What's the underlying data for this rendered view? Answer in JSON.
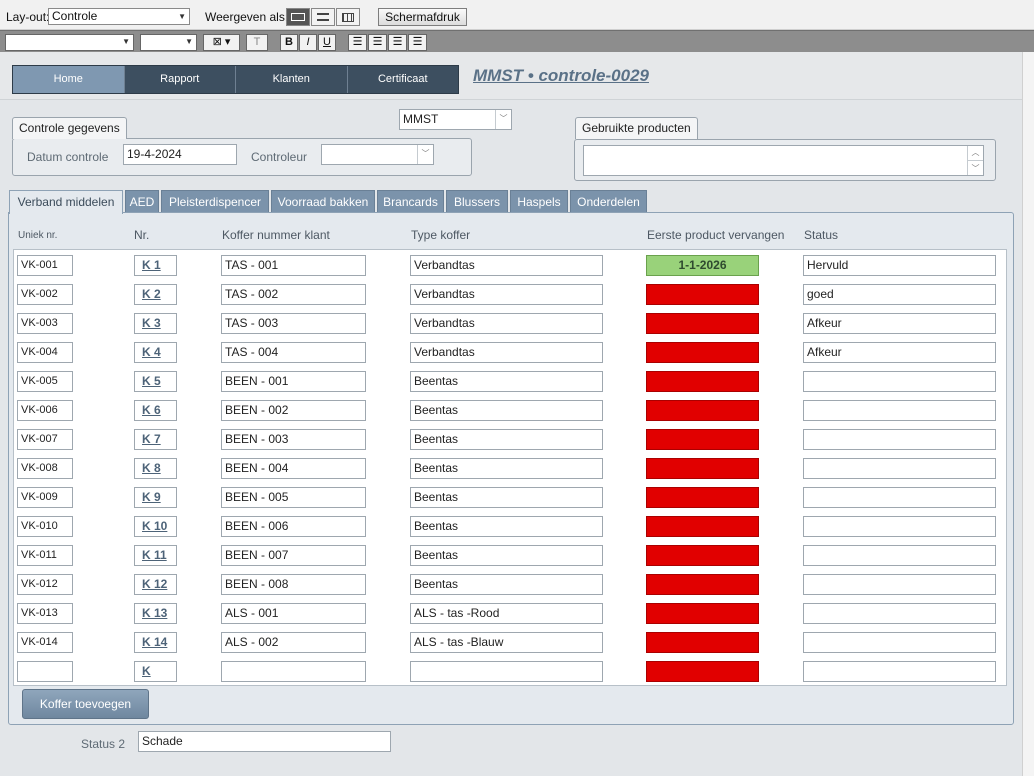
{
  "toolbar": {
    "layout_label": "Lay-out:",
    "layout_value": "Controle",
    "view_label": "Weergeven als:",
    "screenshot_button": "Schermafdruk",
    "format_bold": "B",
    "format_italic": "I",
    "format_underline": "U",
    "format_text": "T"
  },
  "nav": {
    "items": [
      "Home",
      "Rapport",
      "Klanten",
      "Certificaat"
    ],
    "active": "Home"
  },
  "page_title": "MMST  •  controle-0029",
  "controle": {
    "group_title": "Controle gegevens",
    "date_label": "Datum controle",
    "date_value": "19-4-2024",
    "controleur_label": "Controleur",
    "controleur_value": "",
    "company_value": "MMST"
  },
  "products": {
    "group_title": "Gebruikte producten",
    "value": ""
  },
  "tabs": [
    "Verband middelen",
    "AED",
    "Pleisterdispencer",
    "Voorraad bakken",
    "Brancards",
    "Blussers",
    "Haspels",
    "Onderdelen"
  ],
  "table": {
    "headers": {
      "uniek": "Uniek nr.",
      "nr": "Nr.",
      "koffer": "Koffer nummer klant",
      "type": "Type koffer",
      "eerste": "Eerste product vervangen",
      "status": "Status"
    },
    "rows": [
      {
        "uniek": "VK-001",
        "nr": "K 1",
        "koffer": "TAS - 001",
        "type": "Verbandtas",
        "eerste": "1-1-2026",
        "ok": true,
        "status": "Hervuld"
      },
      {
        "uniek": "VK-002",
        "nr": "K 2",
        "koffer": "TAS - 002",
        "type": "Verbandtas",
        "eerste": "",
        "ok": false,
        "status": "goed"
      },
      {
        "uniek": "VK-003",
        "nr": "K 3",
        "koffer": "TAS - 003",
        "type": "Verbandtas",
        "eerste": "",
        "ok": false,
        "status": "Afkeur"
      },
      {
        "uniek": "VK-004",
        "nr": "K 4",
        "koffer": "TAS - 004",
        "type": "Verbandtas",
        "eerste": "",
        "ok": false,
        "status": "Afkeur"
      },
      {
        "uniek": "VK-005",
        "nr": "K 5",
        "koffer": "BEEN - 001",
        "type": "Beentas",
        "eerste": "",
        "ok": false,
        "status": ""
      },
      {
        "uniek": "VK-006",
        "nr": "K 6",
        "koffer": "BEEN - 002",
        "type": "Beentas",
        "eerste": "",
        "ok": false,
        "status": ""
      },
      {
        "uniek": "VK-007",
        "nr": "K 7",
        "koffer": "BEEN - 003",
        "type": "Beentas",
        "eerste": "",
        "ok": false,
        "status": ""
      },
      {
        "uniek": "VK-008",
        "nr": "K 8",
        "koffer": "BEEN - 004",
        "type": "Beentas",
        "eerste": "",
        "ok": false,
        "status": ""
      },
      {
        "uniek": "VK-009",
        "nr": "K 9",
        "koffer": "BEEN - 005",
        "type": "Beentas",
        "eerste": "",
        "ok": false,
        "status": ""
      },
      {
        "uniek": "VK-010",
        "nr": "K 10",
        "koffer": "BEEN - 006",
        "type": "Beentas",
        "eerste": "",
        "ok": false,
        "status": ""
      },
      {
        "uniek": "VK-011",
        "nr": "K 11",
        "koffer": "BEEN - 007",
        "type": "Beentas",
        "eerste": "",
        "ok": false,
        "status": ""
      },
      {
        "uniek": "VK-012",
        "nr": "K 12",
        "koffer": "BEEN - 008",
        "type": "Beentas",
        "eerste": "",
        "ok": false,
        "status": ""
      },
      {
        "uniek": "VK-013",
        "nr": "K 13",
        "koffer": "ALS - 001",
        "type": "ALS - tas -Rood",
        "eerste": "",
        "ok": false,
        "status": ""
      },
      {
        "uniek": "VK-014",
        "nr": "K 14",
        "koffer": "ALS - 002",
        "type": "ALS - tas -Blauw",
        "eerste": "",
        "ok": false,
        "status": ""
      },
      {
        "uniek": "",
        "nr": "K",
        "koffer": "",
        "type": "",
        "eerste": "",
        "ok": false,
        "status": ""
      }
    ]
  },
  "add_button": "Koffer toevoegen",
  "status2": {
    "label": "Status 2",
    "value": "Schade"
  },
  "colors": {
    "nav_bg": "#3d4f60",
    "nav_active": "#7f98b1",
    "tab_bg": "#7b93ab",
    "title": "#5a7187",
    "date_red": "#e10000",
    "date_green": "#99d27a"
  }
}
